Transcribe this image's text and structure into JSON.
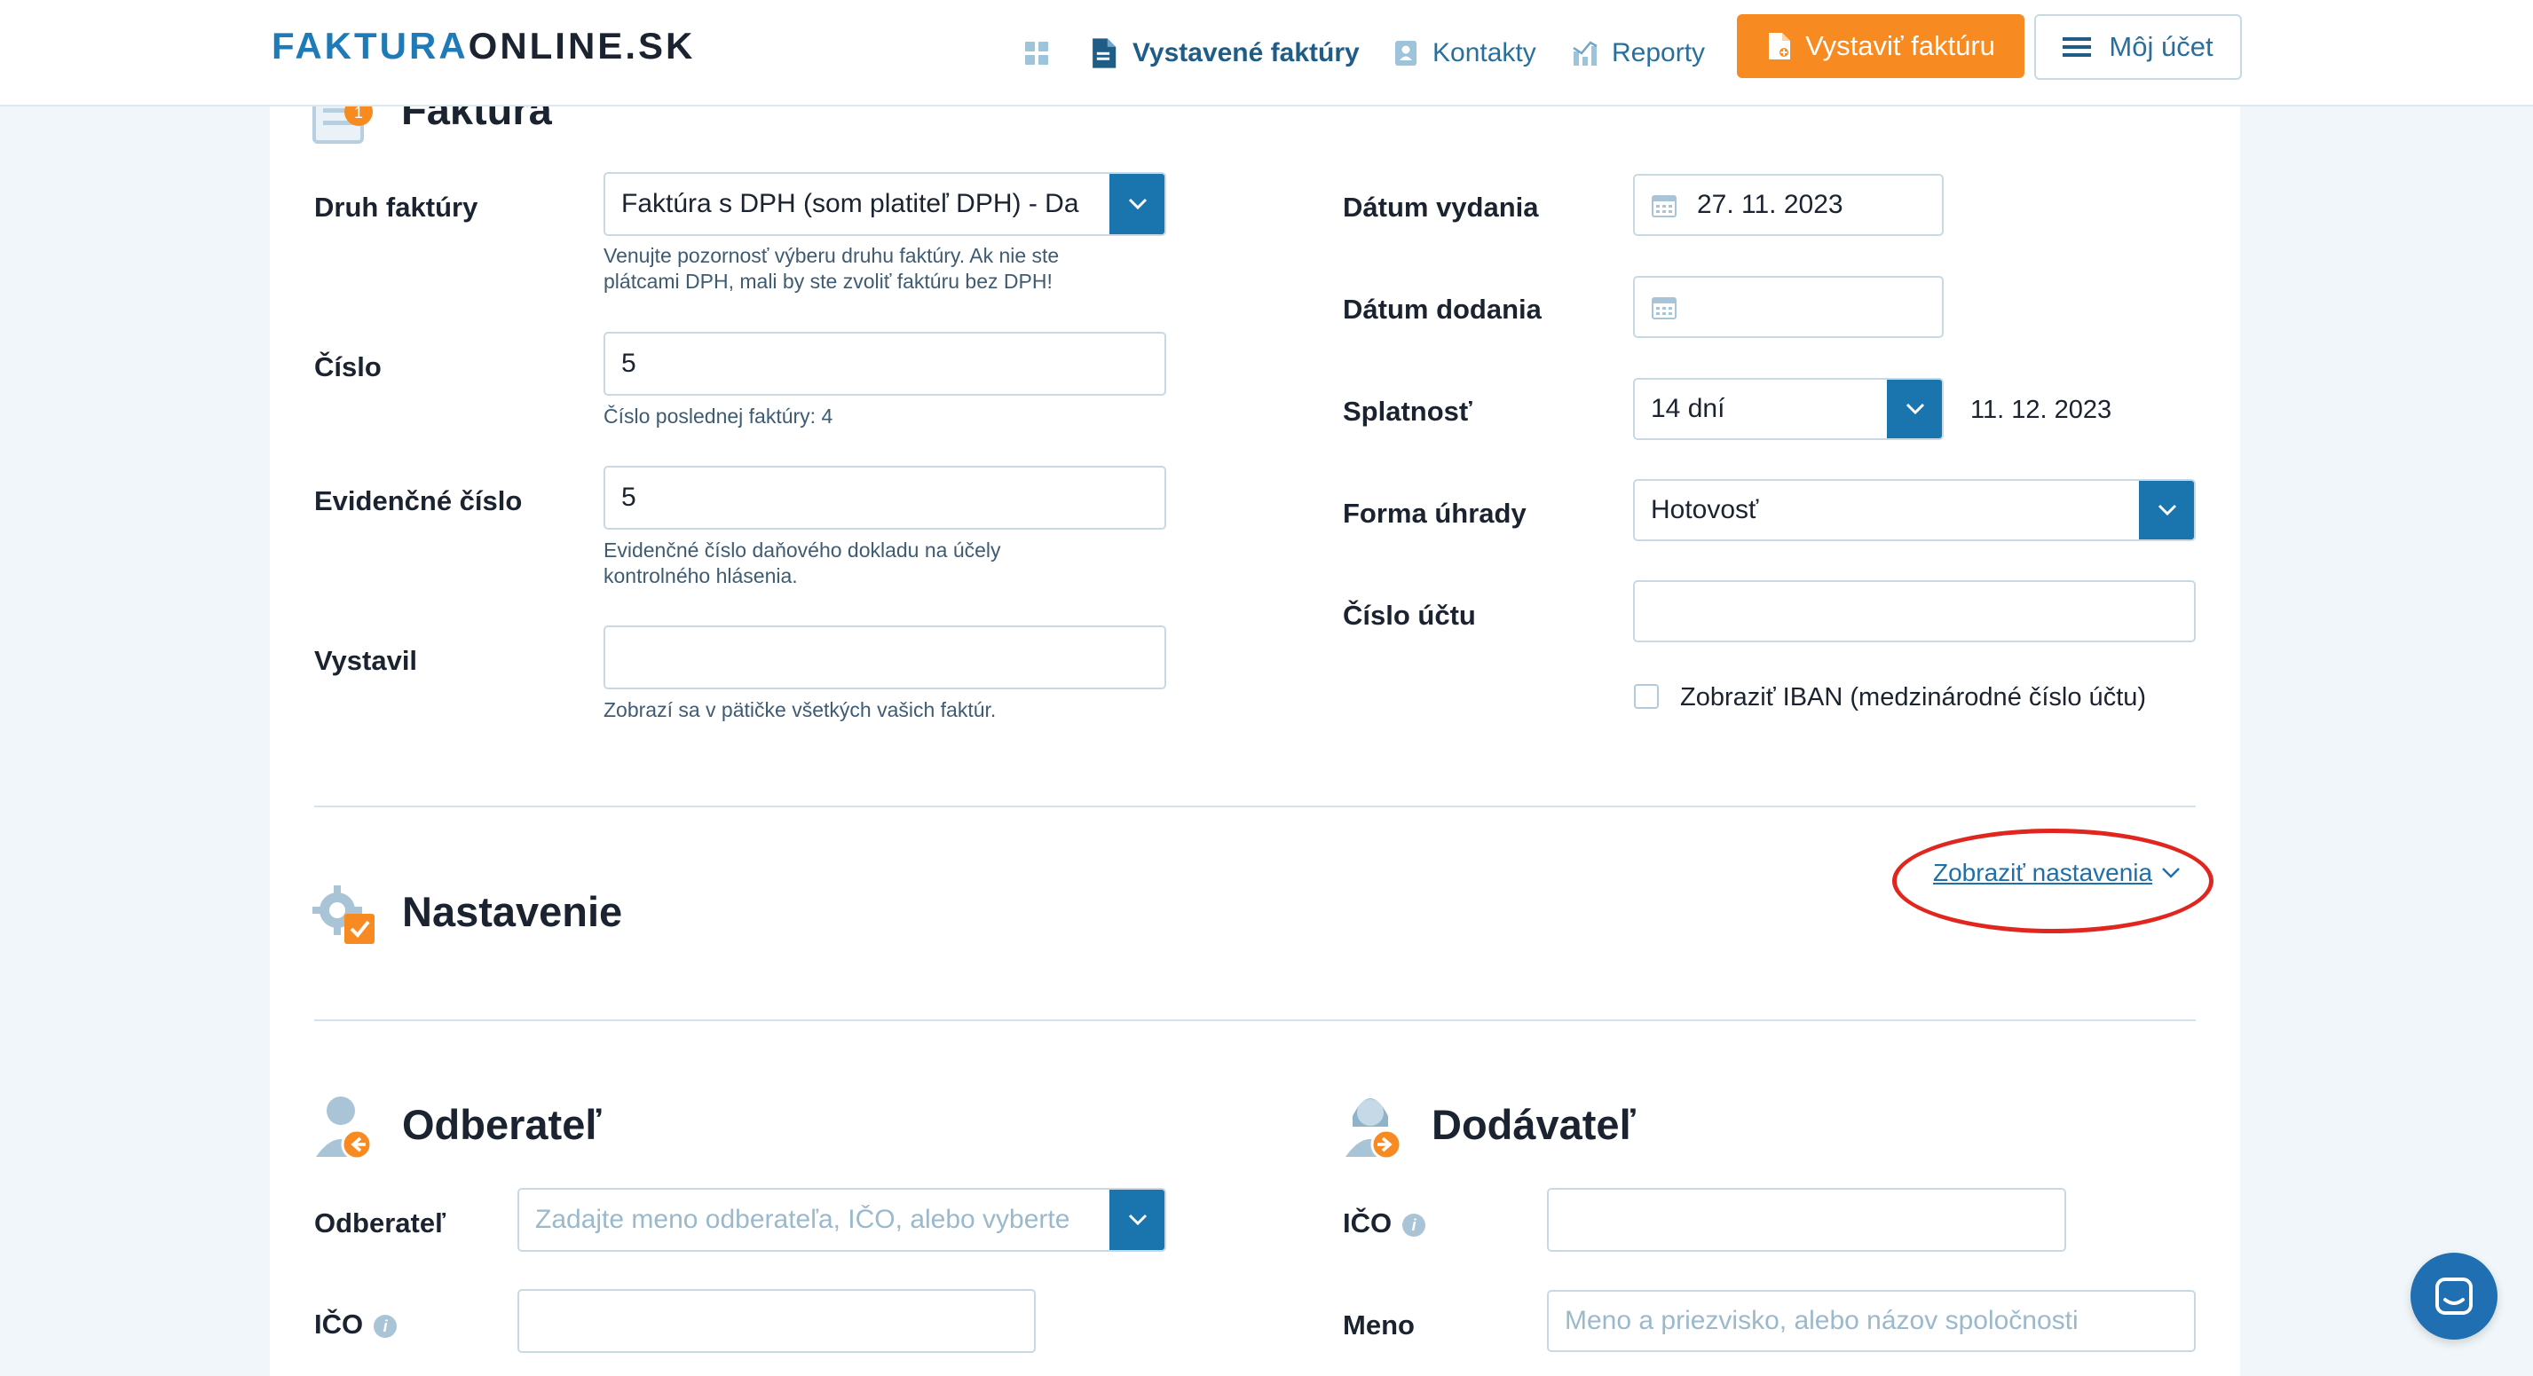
{
  "header": {
    "logo_part1": "FAKTURA",
    "logo_part2": "ONLINE.SK",
    "nav": {
      "invoices": "Vystavené faktúry",
      "contacts": "Kontakty",
      "reports": "Reporty"
    },
    "create_invoice": "Vystaviť faktúru",
    "account": "Môj účet"
  },
  "invoice": {
    "title": "Faktúra",
    "type_label": "Druh faktúry",
    "type_value": "Faktúra s DPH (som platiteľ DPH) - Da",
    "type_hint_1": "Venujte pozornosť výberu druhu faktúry. Ak nie ste",
    "type_hint_2": "plátcami DPH, mali by ste zvoliť faktúru bez DPH!",
    "number_label": "Číslo",
    "number_value": "5",
    "number_hint": "Číslo poslednej faktúry: 4",
    "evidence_label": "Evidenčné číslo",
    "evidence_value": "5",
    "evidence_hint_1": "Evidenčné číslo daňového dokladu na účely",
    "evidence_hint_2": "kontrolného hlásenia.",
    "issued_by_label": "Vystavil",
    "issued_by_value": "",
    "issued_by_hint": "Zobrazí sa v pätičke všetkých vašich faktúr.",
    "issue_date_label": "Dátum vydania",
    "issue_date_value": "27. 11. 2023",
    "delivery_date_label": "Dátum dodania",
    "delivery_date_value": "",
    "due_label": "Splatnosť",
    "due_value": "14 dní",
    "due_date": "11. 12. 2023",
    "payment_label": "Forma úhrady",
    "payment_value": "Hotovosť",
    "account_label": "Číslo účtu",
    "account_value": "",
    "iban_label": "Zobraziť IBAN (medzinárodné číslo účtu)"
  },
  "settings": {
    "title": "Nastavenie",
    "show_link": "Zobraziť nastavenia"
  },
  "customer": {
    "title": "Odberateľ",
    "name_label": "Odberateľ",
    "name_placeholder": "Zadajte meno odberateľa, IČO, alebo vyberte",
    "ico_label": "IČO",
    "ico_value": ""
  },
  "supplier": {
    "title": "Dodávateľ",
    "ico_label": "IČO",
    "ico_value": "",
    "name_label": "Meno",
    "name_placeholder": "Meno a priezvisko, alebo názov spoločnosti"
  },
  "colors": {
    "accent_blue": "#1a74ad",
    "accent_orange": "#f78a21",
    "highlight_red": "#e0261f"
  }
}
